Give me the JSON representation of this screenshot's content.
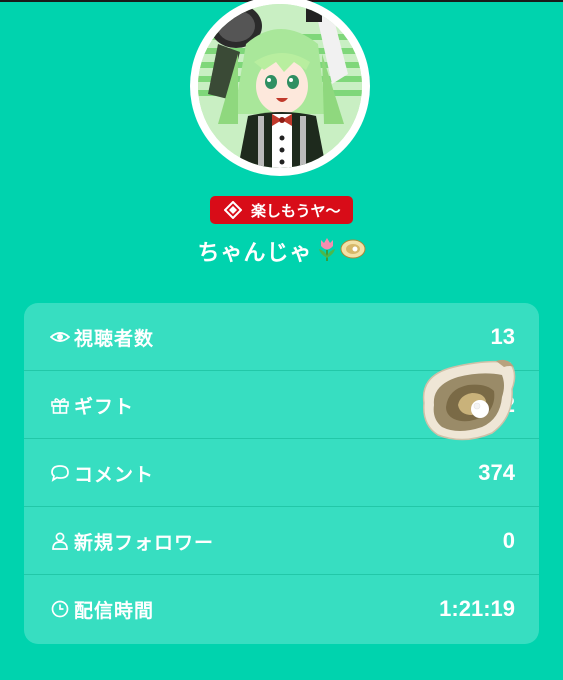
{
  "badge": {
    "icon": "diamond-icon",
    "label": "楽しもうヤ〜",
    "color": "#D80C18"
  },
  "streamer": {
    "name": "ちゃんじゃ",
    "emojis": [
      "tulip-icon",
      "oyster-icon"
    ]
  },
  "stats": [
    {
      "icon": "eye-icon",
      "label": "視聴者数",
      "value": "13"
    },
    {
      "icon": "gift-icon",
      "label": "ギフト",
      "value": "2"
    },
    {
      "icon": "comment-icon",
      "label": "コメント",
      "value": "374"
    },
    {
      "icon": "person-icon",
      "label": "新規フォロワー",
      "value": "0"
    },
    {
      "icon": "clock-icon",
      "label": "配信時間",
      "value": "1:21:19"
    }
  ],
  "colors": {
    "background": "#00D3AE",
    "card": "#37DEC1",
    "text": "#FFFFFF"
  }
}
